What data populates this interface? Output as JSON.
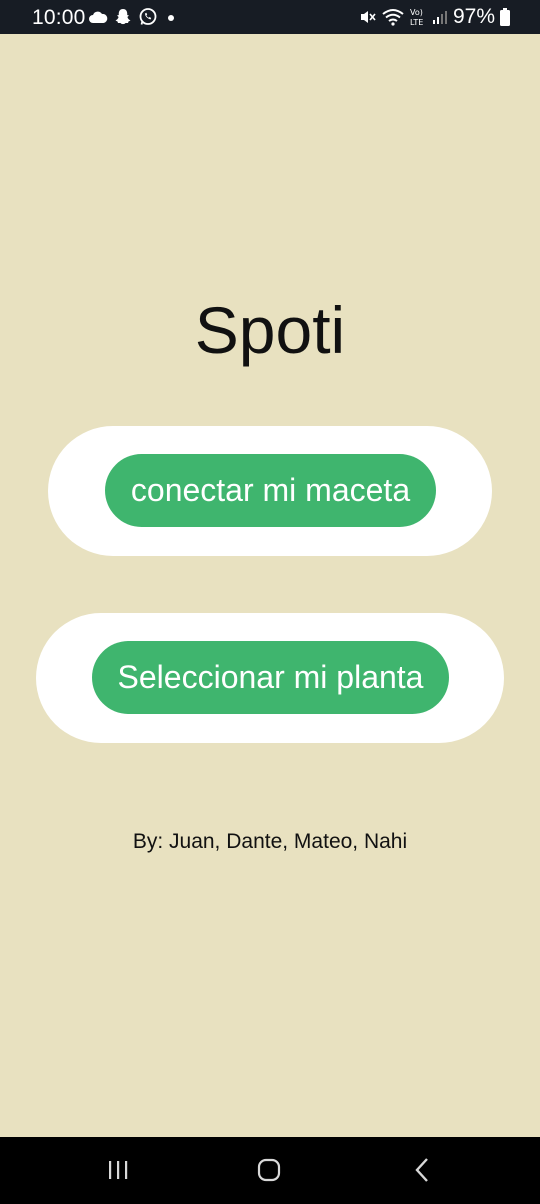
{
  "status_bar": {
    "time": "10:00",
    "battery_percent": "97%",
    "left_icons": [
      "cloud-icon",
      "snapchat-icon",
      "whatsapp-icon",
      "notification-dot-icon"
    ],
    "right_icons": [
      "mute-icon",
      "wifi-icon",
      "volte-lte-icon",
      "signal-icon",
      "battery-icon"
    ]
  },
  "main": {
    "title": "Spoti",
    "buttons": [
      {
        "label": "conectar mi maceta"
      },
      {
        "label": "Seleccionar mi planta"
      }
    ],
    "credits": "By: Juan, Dante, Mateo, Nahi"
  },
  "nav_bar": {
    "icons": [
      "recents-icon",
      "home-icon",
      "back-icon"
    ]
  },
  "colors": {
    "background": "#e8e1c0",
    "button_green": "#3fb56e",
    "card_white": "#ffffff",
    "status_bar": "#171c24",
    "nav_bar": "#000000"
  }
}
